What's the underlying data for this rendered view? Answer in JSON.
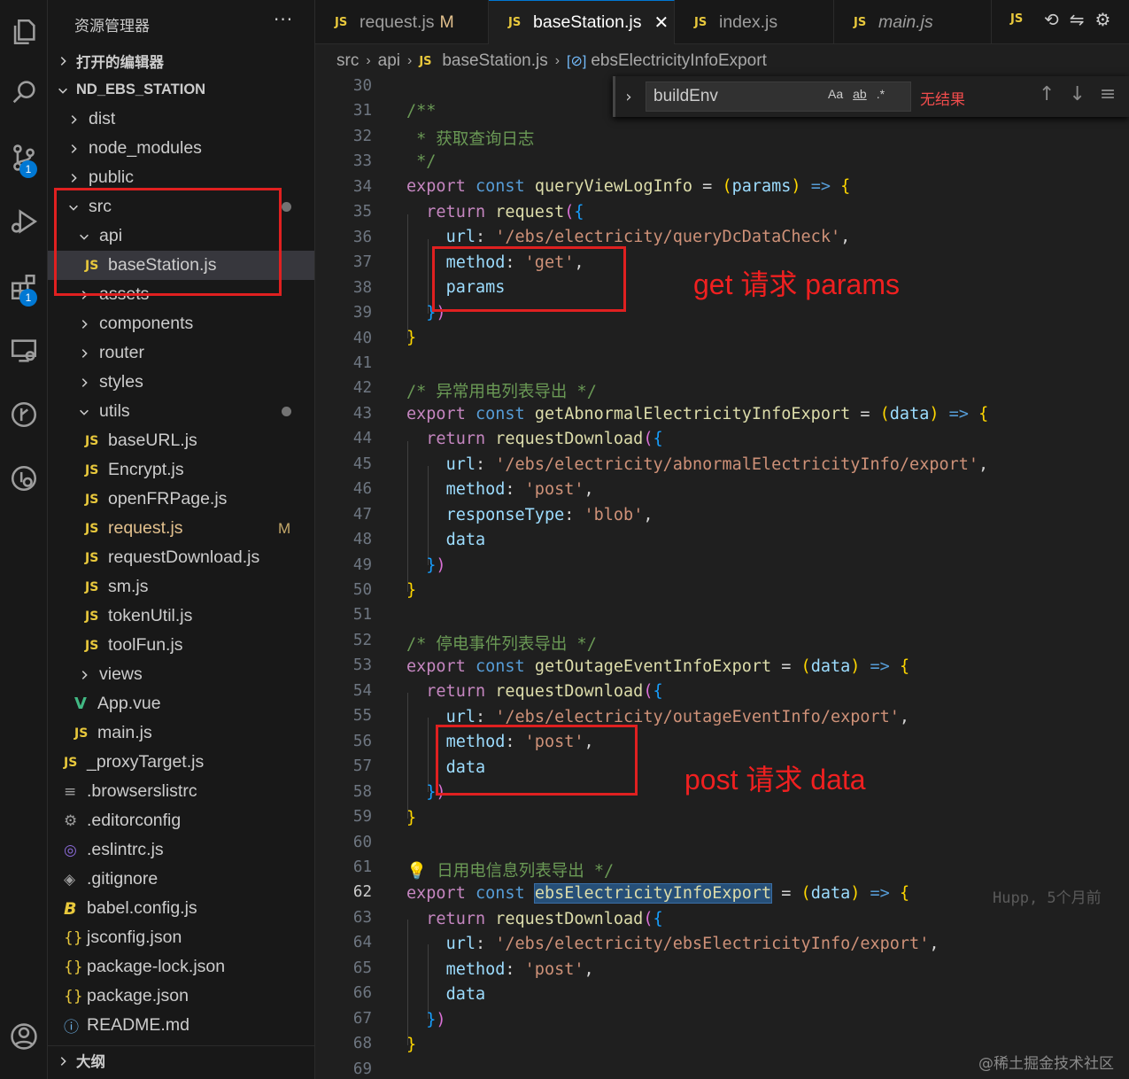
{
  "sidebar": {
    "title": "资源管理器",
    "more": "···",
    "open_editors": "打开的编辑器",
    "project": "ND_EBS_STATION",
    "outline": "大纲",
    "tree": [
      {
        "label": "dist",
        "icon": "chevron-right"
      },
      {
        "label": "node_modules",
        "icon": "chevron-right"
      },
      {
        "label": "public",
        "icon": "chevron-right"
      },
      {
        "label": "src",
        "icon": "chevron-down"
      },
      {
        "label": "api",
        "icon": "chevron-down"
      },
      {
        "label": "baseStation.js",
        "icon": "js"
      },
      {
        "label": "assets",
        "icon": "chevron-right"
      },
      {
        "label": "components",
        "icon": "chevron-right"
      },
      {
        "label": "router",
        "icon": "chevron-right"
      },
      {
        "label": "styles",
        "icon": "chevron-right"
      },
      {
        "label": "utils",
        "icon": "chevron-down"
      },
      {
        "label": "baseURL.js",
        "icon": "js"
      },
      {
        "label": "Encrypt.js",
        "icon": "js"
      },
      {
        "label": "openFRPage.js",
        "icon": "js"
      },
      {
        "label": "request.js",
        "icon": "js",
        "git": "M"
      },
      {
        "label": "requestDownload.js",
        "icon": "js"
      },
      {
        "label": "sm.js",
        "icon": "js"
      },
      {
        "label": "tokenUtil.js",
        "icon": "js"
      },
      {
        "label": "toolFun.js",
        "icon": "js"
      },
      {
        "label": "views",
        "icon": "chevron-right"
      },
      {
        "label": "App.vue",
        "icon": "vue"
      },
      {
        "label": "main.js",
        "icon": "js"
      },
      {
        "label": "_proxyTarget.js",
        "icon": "js"
      },
      {
        "label": ".browserslistrc",
        "icon": "list"
      },
      {
        "label": ".editorconfig",
        "icon": "gear"
      },
      {
        "label": ".eslintrc.js",
        "icon": "eslint"
      },
      {
        "label": ".gitignore",
        "icon": "git"
      },
      {
        "label": "babel.config.js",
        "icon": "babel"
      },
      {
        "label": "jsconfig.json",
        "icon": "json"
      },
      {
        "label": "package-lock.json",
        "icon": "json"
      },
      {
        "label": "package.json",
        "icon": "json"
      },
      {
        "label": "README.md",
        "icon": "info"
      }
    ]
  },
  "tabs": [
    {
      "label": "request.js",
      "badge": "M"
    },
    {
      "label": "baseStation.js",
      "close": "✕"
    },
    {
      "label": "index.js"
    },
    {
      "label": "main.js"
    }
  ],
  "tab_icon": "JS",
  "breadcrumb": [
    "src",
    "api",
    "baseStation.js",
    "ebsElectricityInfoExport"
  ],
  "find": {
    "value": "buildEnv",
    "match_case": "Aa",
    "whole_word": "ab",
    "regex": ".*",
    "status": "无结果"
  },
  "editor": {
    "line_numbers": [
      "30",
      "31",
      "32",
      "33",
      "34",
      "35",
      "36",
      "37",
      "38",
      "39",
      "40",
      "41",
      "42",
      "43",
      "44",
      "45",
      "46",
      "47",
      "48",
      "49",
      "50",
      "51",
      "52",
      "53",
      "54",
      "55",
      "56",
      "57",
      "58",
      "59",
      "60",
      "61",
      "62",
      "63",
      "64",
      "65",
      "66",
      "67",
      "68",
      "69"
    ],
    "current_line": "62",
    "blame": "Hupp, 5个月前"
  },
  "annotations": {
    "get": "get 请求 params",
    "post": "post 请求  data"
  },
  "watermark": "@稀土掘金技术社区",
  "badges": {
    "scm": "1",
    "extensions": "1"
  }
}
